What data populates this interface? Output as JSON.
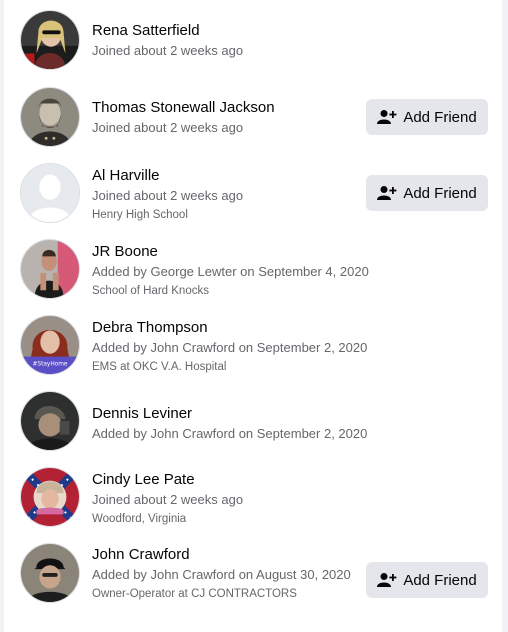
{
  "friends": [
    {
      "name": "Rena Satterfield",
      "meta": "Joined about 2 weeks ago",
      "sub": "",
      "button": ""
    },
    {
      "name": "Thomas Stonewall Jackson",
      "meta": "Joined about 2 weeks ago",
      "sub": "",
      "button": "Add Friend"
    },
    {
      "name": "Al Harville",
      "meta": "Joined about 2 weeks ago",
      "sub": "Henry High School",
      "button": "Add Friend"
    },
    {
      "name": "JR Boone",
      "meta": "Added by George Lewter on September 4, 2020",
      "sub": "School of Hard Knocks",
      "button": ""
    },
    {
      "name": "Debra Thompson",
      "meta": "Added by John Crawford on September 2, 2020",
      "sub": "EMS at OKC V.A. Hospital",
      "button": "",
      "avatar_text": "#StayHome"
    },
    {
      "name": "Dennis Leviner",
      "meta": "Added by John Crawford on September 2, 2020",
      "sub": "",
      "button": ""
    },
    {
      "name": "Cindy Lee Pate",
      "meta": "Joined about 2 weeks ago",
      "sub": "Woodford, Virginia",
      "button": ""
    },
    {
      "name": "John Crawford",
      "meta": "Added by John Crawford on August 30, 2020",
      "sub": "Owner-Operator at CJ CONTRACTORS",
      "button": "Add Friend"
    }
  ],
  "icons": {
    "add_friend": "person-plus-icon"
  },
  "colors": {
    "button_bg": "#e4e6eb",
    "secondary_text": "#65676b",
    "primary_text": "#050505"
  }
}
